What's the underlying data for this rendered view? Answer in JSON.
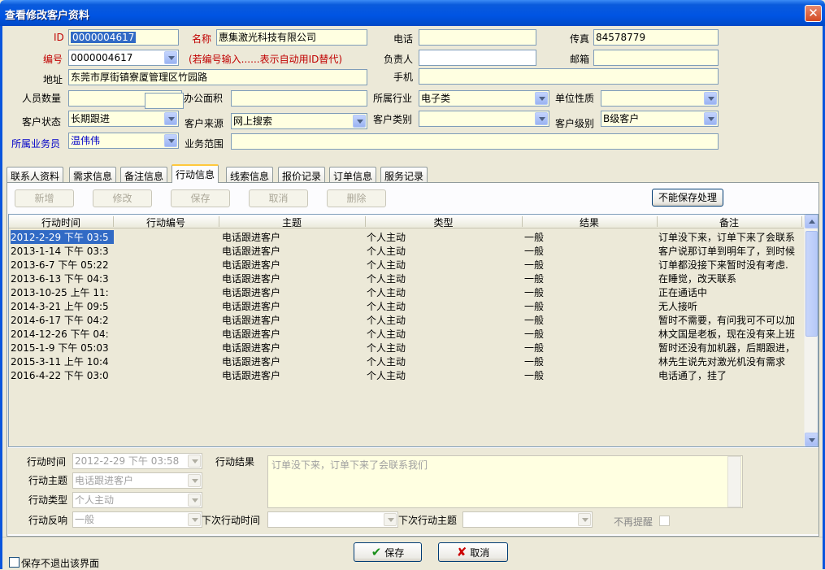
{
  "window": {
    "title": "查看修改客户资料",
    "close_glyph": "✕"
  },
  "form": {
    "id_label": "ID",
    "id_value": "0000004617",
    "name_label": "名称",
    "name_value": "惠集激光科技有限公司",
    "phone_label": "电话",
    "phone_value": "",
    "fax_label": "传真",
    "fax_value": "84578779",
    "code_label": "编号",
    "code_value": "0000004617",
    "code_hint": "(若编号输入......表示自动用ID替代)",
    "owner_label": "负责人",
    "owner_value": "",
    "email_label": "邮箱",
    "email_value": "",
    "mobile_label": "手机",
    "mobile_value": "",
    "address_label": "地址",
    "address_value": "东莞市厚街镇寮厦管理区竹园路",
    "staff_label": "人员数量",
    "staff_value": "",
    "office_label": "办公面积",
    "office_value": "",
    "industry_label": "所属行业",
    "industry_value": "电子类",
    "unit_label": "单位性质",
    "unit_value": "",
    "status_label": "客户状态",
    "status_value": "长期跟进",
    "source_label": "客户来源",
    "source_value": "网上搜索",
    "category_label": "客户类别",
    "category_value": "",
    "level_label": "客户级别",
    "level_value": "B级客户",
    "salesman_label": "所属业务员",
    "salesman_value": "温伟伟",
    "scope_label": "业务范围",
    "scope_value": ""
  },
  "tabs": [
    "联系人资料",
    "需求信息",
    "备注信息",
    "行动信息",
    "线索信息",
    "报价记录",
    "订单信息",
    "服务记录"
  ],
  "toolbar": {
    "add": "新增",
    "edit": "修改",
    "save": "保存",
    "cancel": "取消",
    "delete": "删除",
    "cannot_save": "不能保存处理"
  },
  "grid": {
    "columns": [
      "行动时间",
      "行动编号",
      "主题",
      "类型",
      "结果",
      "备注"
    ],
    "rows": [
      [
        "2012-2-29 下午 03:5",
        "",
        "电话跟进客户",
        "个人主动",
        "一般",
        "订单没下来，订单下来了会联系"
      ],
      [
        "2013-1-14 下午 03:3",
        "",
        "电话跟进客户",
        "个人主动",
        "一般",
        "客户说那订单到明年了，到时候"
      ],
      [
        "2013-6-7 下午 05:22",
        "",
        "电话跟进客户",
        "个人主动",
        "一般",
        "订单都没接下来暂时没有考虑."
      ],
      [
        "2013-6-13 下午 04:3",
        "",
        "电话跟进客户",
        "个人主动",
        "一般",
        "在睡觉，改天联系"
      ],
      [
        "2013-10-25 上午 11:",
        "",
        "电话跟进客户",
        "个人主动",
        "一般",
        "正在通话中"
      ],
      [
        "2014-3-21 上午 09:5",
        "",
        "电话跟进客户",
        "个人主动",
        "一般",
        "无人接听"
      ],
      [
        "2014-6-17 下午 04:2",
        "",
        "电话跟进客户",
        "个人主动",
        "一般",
        "暂时不需要，有问我可不可以加"
      ],
      [
        "2014-12-26 下午 04:",
        "",
        "电话跟进客户",
        "个人主动",
        "一般",
        "林文国是老板，现在没有来上班"
      ],
      [
        "2015-1-9 下午 05:03",
        "",
        "电话跟进客户",
        "个人主动",
        "一般",
        "暂时还没有加机器，后期跟进，"
      ],
      [
        "2015-3-11 上午 10:4",
        "",
        "电话跟进客户",
        "个人主动",
        "一般",
        "林先生说先对激光机没有需求"
      ],
      [
        "2016-4-22 下午 03:0",
        "",
        "电话跟进客户",
        "个人主动",
        "一般",
        "电话通了，挂了"
      ]
    ]
  },
  "detail": {
    "time_label": "行动时间",
    "time_value": "2012-2-29 下午 03:58",
    "result_label": "行动结果",
    "result_value": "订单没下来，订单下来了会联系我们",
    "topic_label": "行动主题",
    "topic_value": "电话跟进客户",
    "type_label": "行动类型",
    "type_value": "个人主动",
    "response_label": "行动反响",
    "response_value": "一般",
    "next_time_label": "下次行动时间",
    "next_time_value": "",
    "next_topic_label": "下次行动主题",
    "next_topic_value": "",
    "no_remind_label": "不再提醒"
  },
  "footer": {
    "save": "保存",
    "cancel": "取消",
    "stay_label": "保存不退出该界面",
    "save_icon": "✔",
    "cancel_icon": "✘"
  }
}
